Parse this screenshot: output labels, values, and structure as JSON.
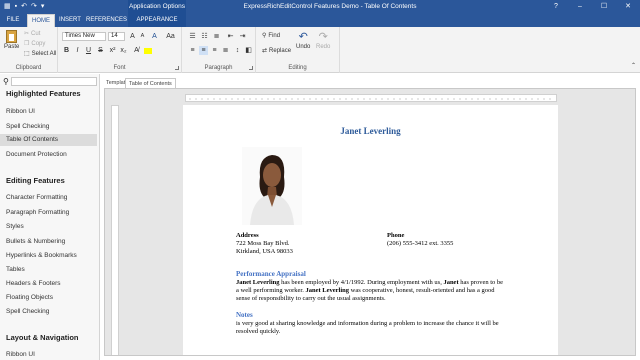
{
  "app": {
    "title": "ExpressRichEditControl Features Demo -  Table Of Contents",
    "contextual_group": "Application Options"
  },
  "ribbon_tabs": [
    "FILE",
    "HOME",
    "INSERT",
    "REFERENCES",
    "APPEARANCE"
  ],
  "clipboard": {
    "paste": "Paste",
    "cut": "Cut",
    "copy": "Copy",
    "select_all": "Select All",
    "label": "Clipboard"
  },
  "font": {
    "family": "Times New",
    "size": "14",
    "label": "Font"
  },
  "paragraph": {
    "label": "Paragraph"
  },
  "editing": {
    "find": "Find",
    "replace": "Replace",
    "undo": "Undo",
    "redo": "Redo",
    "label": "Editing"
  },
  "left_panel": {
    "sections": [
      {
        "title": "Highlighted Features",
        "items": [
          "Ribbon UI",
          "Spell Checking",
          "Table Of Contents",
          "Document Protection"
        ]
      },
      {
        "title": "Editing Features",
        "items": [
          "Character Formatting",
          "Paragraph Formatting",
          "Styles",
          "Bullets & Numbering",
          "Hyperlinks & Bookmarks",
          "Tables",
          "Headers & Footers",
          "Floating Objects",
          "Spell Checking"
        ]
      },
      {
        "title": "Layout & Navigation",
        "items": [
          "Ribbon UI"
        ]
      }
    ],
    "selected": "Table Of Contents"
  },
  "doc_tabs": [
    "Template",
    "Table of Contents"
  ],
  "document": {
    "name": "Janet Leverling",
    "address_label": "Address",
    "address_line1": "722 Moss Bay Blvd.",
    "address_line2": "Kirkland, USA 98033",
    "phone_label": "Phone",
    "phone": "(206) 555-3412 ext. 3355",
    "perf_heading": "Performance Appraisal",
    "perf_1a": "Janet Leverling",
    "perf_1b": " has been employed by 4/1/1992. During employment with us, ",
    "perf_1c": "Janet",
    "perf_1d": " has proven to be",
    "perf_2a": "a well performing worker. ",
    "perf_2b": "Janet Leverling",
    "perf_2c": " was cooperative, honest, result-oriented and has a good",
    "perf_3": "sense of responsibility to carry out the usual assignments.",
    "notes_heading": "Notes",
    "notes_1": "is very good at sharing knowledge and information during a problem to increase the chance it will be",
    "notes_2": "resolved quickly."
  },
  "colors": {
    "accent": "#2b579a",
    "heading": "#2e5b9a",
    "link_heading": "#4472c4"
  }
}
